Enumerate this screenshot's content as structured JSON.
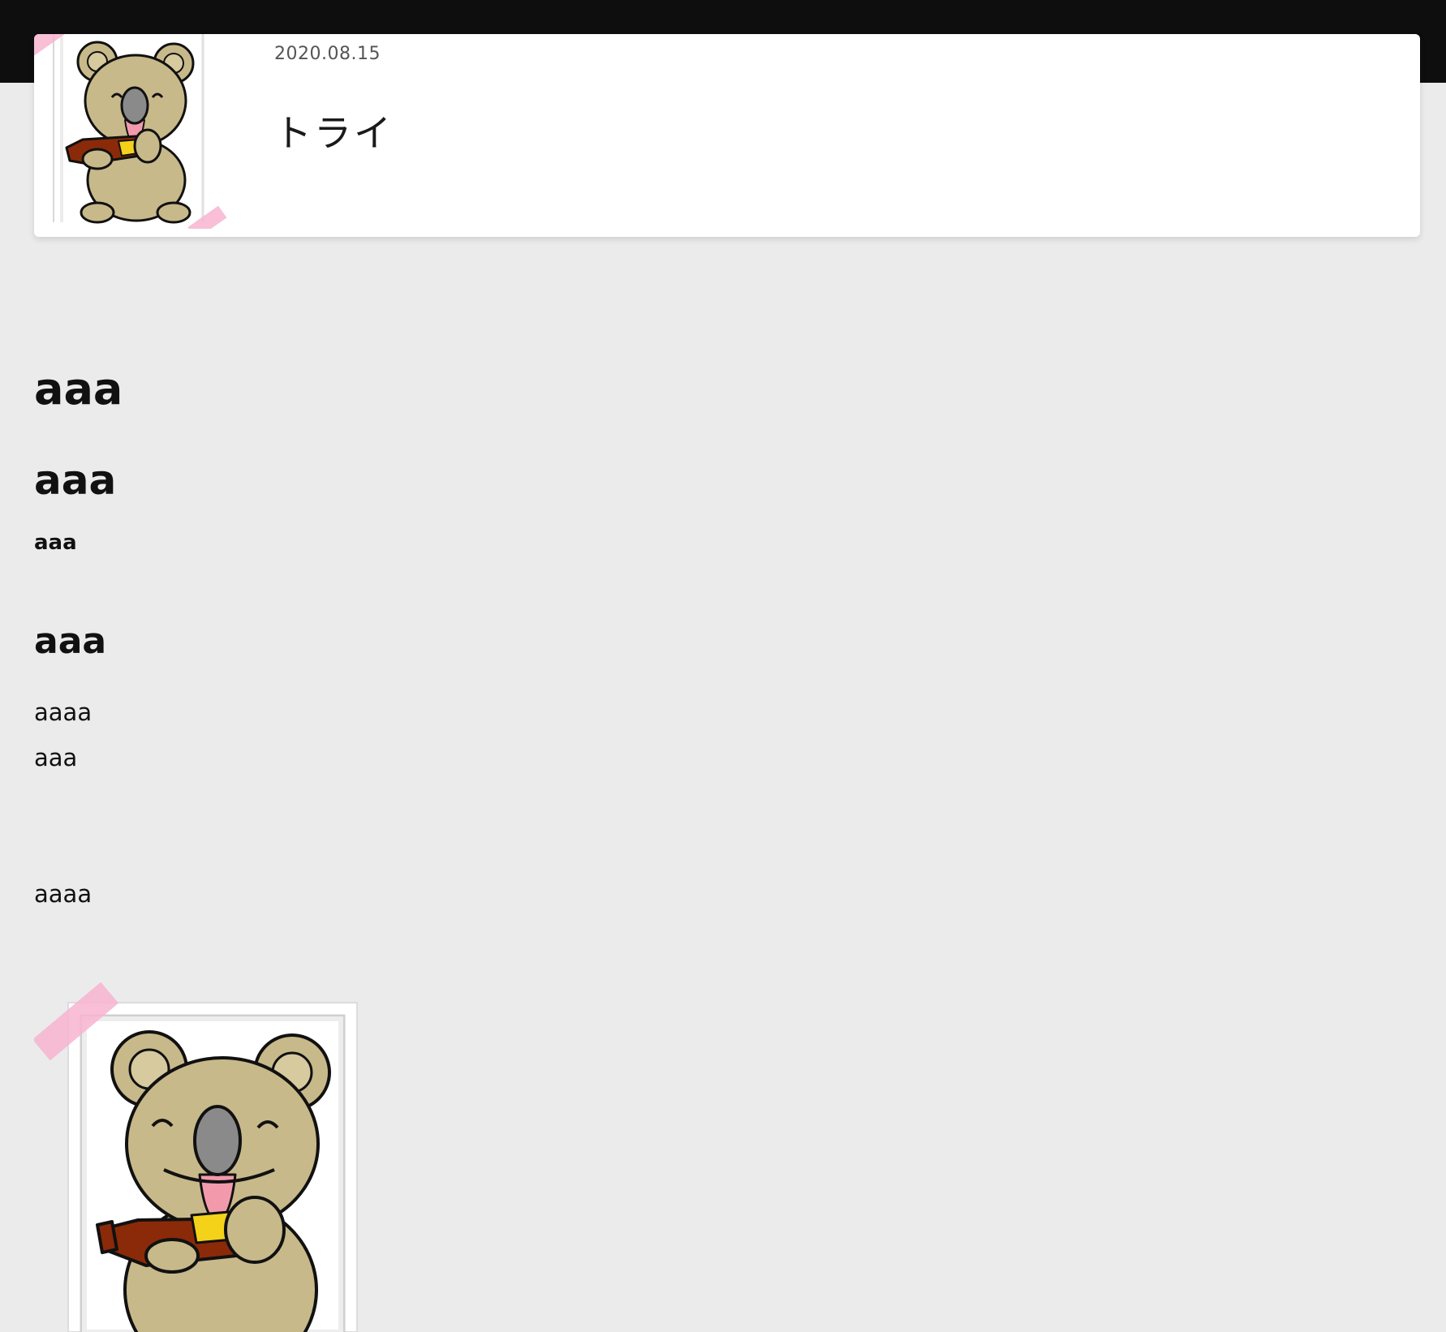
{
  "header": {
    "background_color": "#0e0e0e"
  },
  "card": {
    "date": "2020.08.15",
    "title": "トライ",
    "thumbnail_icon": "koala-with-bottle-illustration"
  },
  "article": {
    "heading1": "aaa",
    "heading2": "aaa",
    "paragraph1": "aaa",
    "heading3": "aaa",
    "paragraph2": "aaaa",
    "paragraph3": "aaa",
    "paragraph4": "aaaa",
    "image_icon": "koala-with-bottle-illustration"
  },
  "colors": {
    "page_background": "#ebebeb",
    "tape_pink": "#f7b4d0",
    "koala_fur": "#c8b98a",
    "bottle": "#8b2a08"
  }
}
